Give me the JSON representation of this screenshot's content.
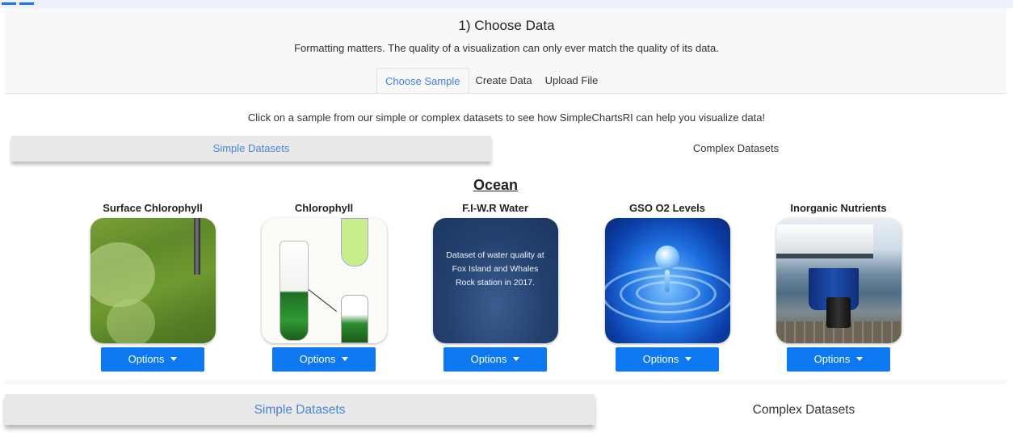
{
  "section": {
    "title": "1) Choose Data",
    "subtitle": "Formatting matters. The quality of a visualization can only ever match the quality of its data."
  },
  "tabs": [
    {
      "label": "Choose Sample",
      "active": true
    },
    {
      "label": "Create Data",
      "active": false
    },
    {
      "label": "Upload File",
      "active": false
    }
  ],
  "instruction": "Click on a sample from our simple or complex datasets to see how SimpleChartsRI can help you visualize data!",
  "dataset_tabs": {
    "simple": "Simple Datasets",
    "complex": "Complex Datasets",
    "active": "simple"
  },
  "category": "Ocean",
  "datasets": [
    {
      "title": "Surface Chlorophyll",
      "button": "Options",
      "image_icon": "algae-photo"
    },
    {
      "title": "Chlorophyll",
      "button": "Options",
      "image_icon": "lab-tubes-diagram"
    },
    {
      "title": "F.I-W.R Water",
      "button": "Options",
      "image_icon": "water-dataset-card",
      "image_text": "Dataset of water quality at Fox Island and Whales Rock station in 2017."
    },
    {
      "title": "GSO O2 Levels",
      "button": "Options",
      "image_icon": "water-drop-photo"
    },
    {
      "title": "Inorganic Nutrients",
      "button": "Options",
      "image_icon": "harbor-bucket-photo"
    }
  ],
  "bottom_tabs": {
    "simple": "Simple Datasets",
    "complex": "Complex Datasets"
  },
  "colors": {
    "accent": "#0d78f0",
    "active_tab_text": "#3f7fd6"
  }
}
